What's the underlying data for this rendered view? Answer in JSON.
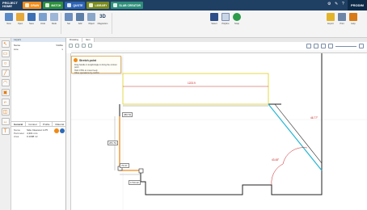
{
  "nav": {
    "brand": "PROJECT HOME",
    "tabs": [
      {
        "label": "DRAW",
        "color": "#f28c1a"
      },
      {
        "label": "MATCH",
        "color": "#2c8f3c"
      },
      {
        "label": "QUOTE",
        "color": "#2e63b4"
      },
      {
        "label": "LIBRARY",
        "color": "#7a8a1c"
      },
      {
        "label": "SLAB CREATOR",
        "color": "#2f8f7a"
      }
    ],
    "logo": "PRODIM"
  },
  "ribbon": {
    "left_labels": [
      "New",
      "Open",
      "Save",
      "Undo",
      "Redo",
      "Set",
      "Add",
      "Object",
      "Measure"
    ],
    "view3d": "3D",
    "view3d_sub": "Magnetism",
    "mid_labels": [
      "Select",
      "Polyline",
      "Snap"
    ],
    "right_labels": [
      "Export",
      "Print",
      "Help"
    ]
  },
  "left_panel": {
    "header": "Layers",
    "tree_head": [
      "Name",
      "Visible"
    ],
    "tree_rows": [
      {
        "name": "Line",
        "vis": "x"
      }
    ],
    "prop_tabs": [
      "General",
      "Contour",
      "Profile",
      "Material"
    ],
    "props": [
      {
        "k": "Name",
        "v": "Side Cleanout 1-P5"
      },
      {
        "k": "Perimeter",
        "v": "4,301 mm"
      },
      {
        "k": "Area",
        "v": "0.1098 m²"
      }
    ]
  },
  "canvas": {
    "tabs": [
      "Drawing",
      "Item"
    ],
    "hint_title": "Stretch point",
    "hint_lines": [
      "Drag handle in length/angle to bring the contour point",
      "Hold CTRL to move freely",
      "Other operations by confirm"
    ],
    "dims": {
      "top": "1223.9",
      "d1": "380.52",
      "d2": "281.51",
      "d3": "76.97",
      "d4": "1733.42"
    },
    "angles": {
      "a1": "46.77°",
      "a2": "43.48°"
    }
  },
  "colors": {
    "accent": "#f28c1a",
    "navy": "#1f3f63",
    "yellow": "#e6d94a",
    "cyan": "#27b7d4"
  }
}
